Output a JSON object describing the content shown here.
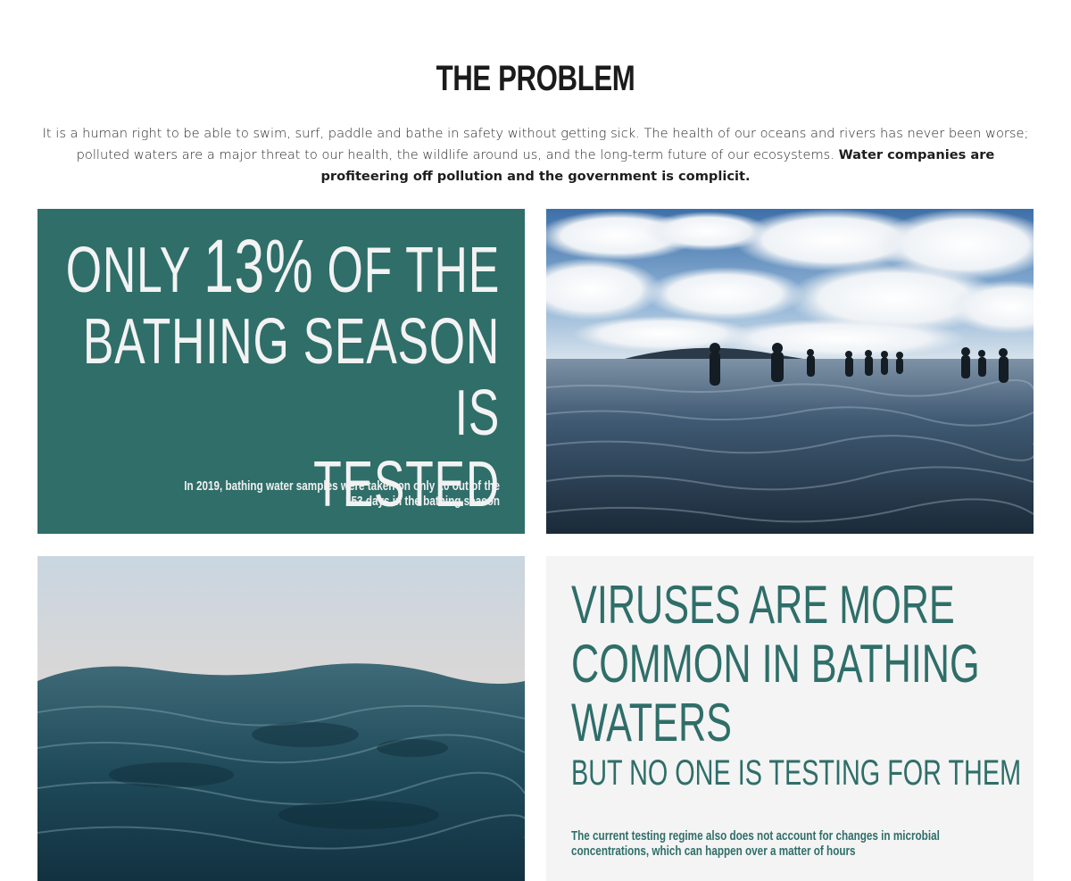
{
  "section": {
    "title": "THE PROBLEM",
    "intro_text": "It is a human right to be able to swim, surf, paddle and bathe in safety without getting sick. The health of our oceans and rivers has never been worse; polluted waters are a major threat to our health, the wildlife around us, and the long-term future of our ecosystems.",
    "intro_emphasis": "Water companies are profiteering off pollution and the government is complicit."
  },
  "stat_card": {
    "headline_pre": "ONLY",
    "headline_number": "13%",
    "headline_post": "OF THE",
    "headline_line2": "BATHING SEASON IS",
    "headline_line3": "TESTED",
    "note": "In 2019, bathing water samples were taken on only 20 out of the 153 days in the bathing season",
    "background_color": "#2f6e69"
  },
  "viruses_card": {
    "headline_line1": "VIRUSES ARE MORE",
    "headline_line2": "COMMON IN BATHING",
    "headline_line3": "WATERS",
    "subheadline": "BUT NO ONE IS TESTING FOR THEM",
    "note": "The current testing regime also does not account for changes in microbial concentrations, which can happen over a matter of hours",
    "accent_color": "#2f6e69"
  },
  "images": {
    "swimmers": "photo-swimmers-in-sea",
    "waves": "photo-sea-waves"
  }
}
